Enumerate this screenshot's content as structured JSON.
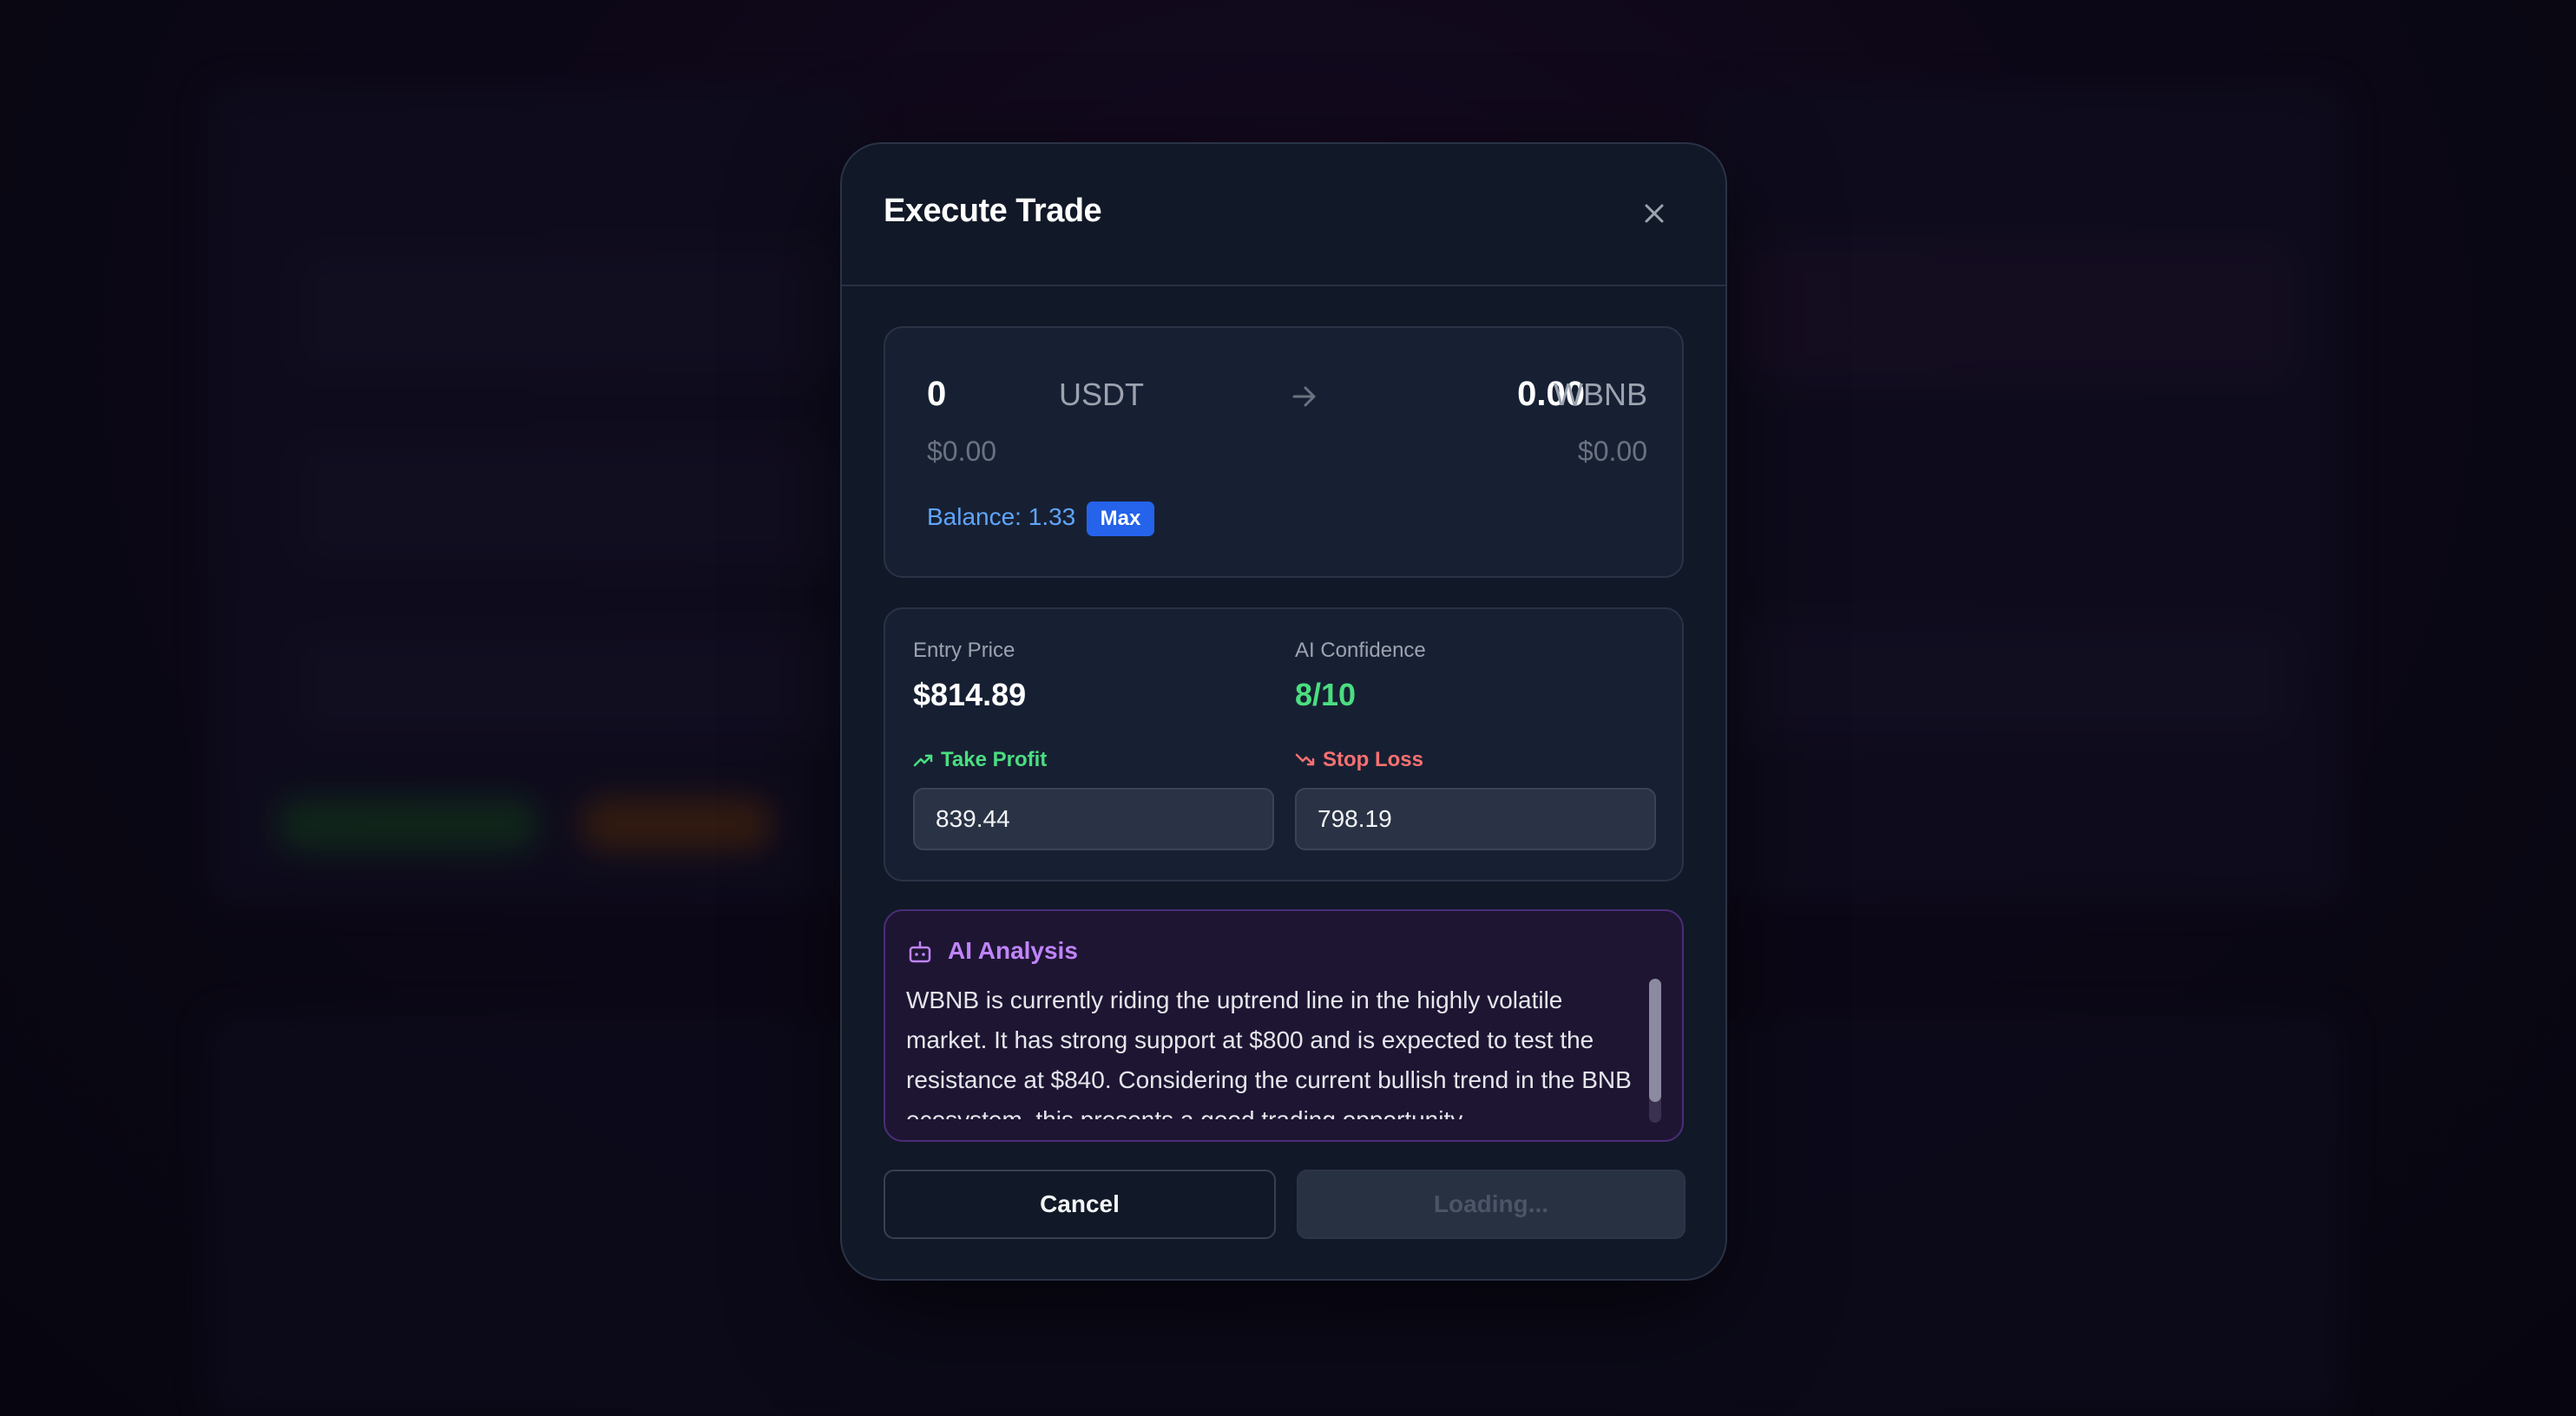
{
  "modal": {
    "title": "Execute Trade",
    "close_icon": "close-icon"
  },
  "swap": {
    "from_amount": "0",
    "from_token": "USDT",
    "from_usd": "$0.00",
    "arrow_icon": "arrow-right-icon",
    "to_amount": "0.00",
    "to_token": "WBNB",
    "to_usd": "$0.00",
    "balance": "Balance: 1.33",
    "max_label": "Max"
  },
  "trade": {
    "entry_price_label": "Entry Price",
    "entry_price_value": "$814.89",
    "ai_confidence_label": "AI Confidence",
    "ai_confidence_value": "8/10",
    "take_profit_label": "Take Profit",
    "take_profit_icon": "trending-up-icon",
    "take_profit_value": "839.44",
    "stop_loss_label": "Stop Loss",
    "stop_loss_icon": "trending-down-icon",
    "stop_loss_value": "798.19"
  },
  "analysis": {
    "title": "AI Analysis",
    "icon": "robot-icon",
    "text": "WBNB is currently riding the uptrend line in the highly volatile market. It has strong support at $800 and is expected to test the resistance at $840. Considering the current bullish trend in the BNB ecosystem, this presents a good trading opportunity."
  },
  "actions": {
    "cancel_label": "Cancel",
    "submit_label": "Loading..."
  },
  "colors": {
    "accent_blue": "#2563eb",
    "profit_green": "#4ade80",
    "loss_red": "#f87171",
    "ai_purple": "#c084fc"
  }
}
